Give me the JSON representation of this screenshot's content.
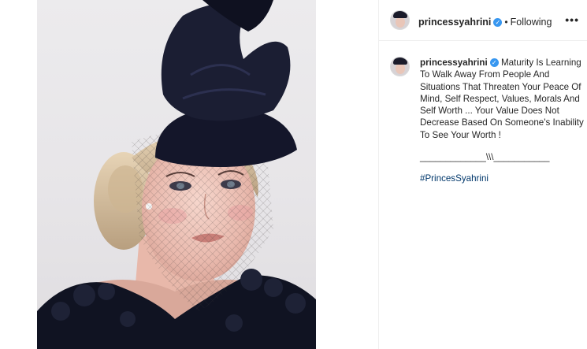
{
  "post": {
    "username": "princessyahrini",
    "follow_status": "Following",
    "separator_dot": "•",
    "more_icon": "more-horizontal-icon",
    "verified_icon": "verified-badge-icon",
    "verified_glyph": "✓",
    "caption": "Maturity Is Learning To Walk Away From People And Situations That Threaten Your Peace Of Mind, Self Respect, Values, Morals And Self Worth ... Your Value Does Not Decrease Based On Someone's Inability To See Your Worth !",
    "caption_separator": "_____________\\\\\\___________",
    "hashtag": "#PrincesSyahrini"
  },
  "colors": {
    "verified": "#3897f0",
    "hashtag": "#00376b",
    "hat": "#14162a"
  }
}
